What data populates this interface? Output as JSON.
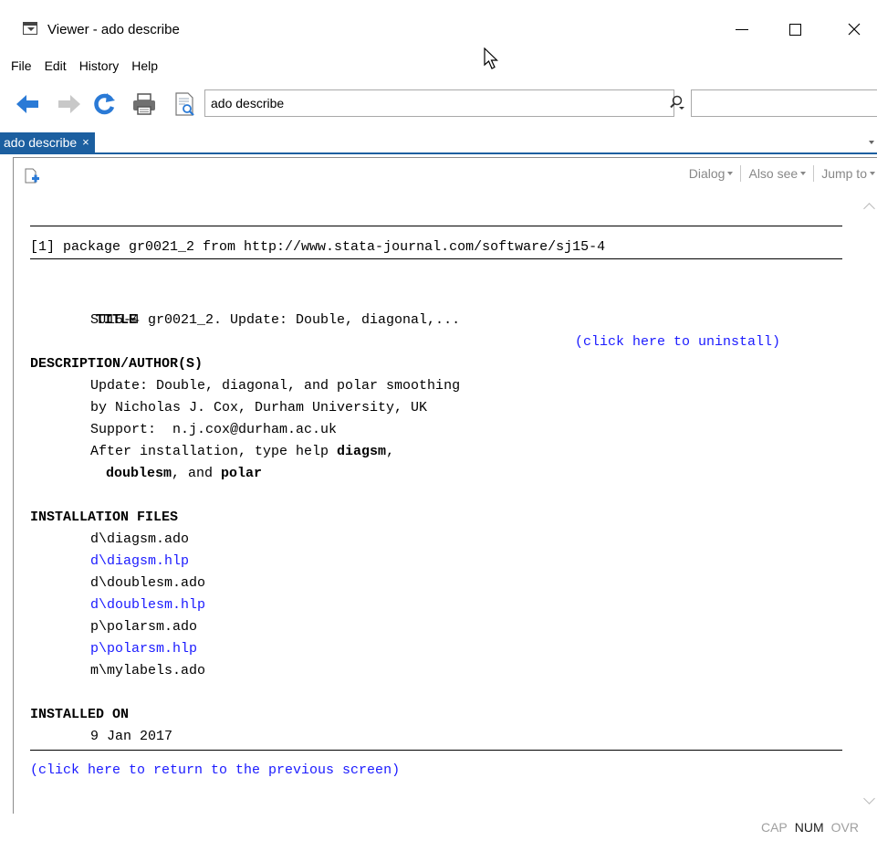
{
  "window": {
    "title": "Viewer - ado describe"
  },
  "menu": [
    "File",
    "Edit",
    "History",
    "Help"
  ],
  "toolbar": {
    "url_value": "ado describe",
    "search_value": ""
  },
  "tab": {
    "label": "ado describe",
    "close": "×"
  },
  "subbar": {
    "dialog": "Dialog",
    "also_see": "Also see",
    "jump_to": "Jump to"
  },
  "doc": {
    "package_line": "[1] package gr0021_2 from http://www.stata-journal.com/software/sj15-4",
    "title_heading": "TITLE",
    "uninstall_link": "(click here to uninstall)",
    "title_text": "SJ15-4 gr0021_2. Update: Double, diagonal,...",
    "desc_heading": "DESCRIPTION/AUTHOR(S)",
    "desc_lines": [
      "Update: Double, diagonal, and polar smoothing",
      "by Nicholas J. Cox, Durham University, UK",
      "Support:  n.j.cox@durham.ac.uk"
    ],
    "after_install_prefix": "After installation, type help ",
    "after_install_cmd1": "diagsm",
    "after_install_sep": ",",
    "after_install_cmd2": "doublesm",
    "after_install_and": ", and ",
    "after_install_cmd3": "polar",
    "files_heading": "INSTALLATION FILES",
    "files": [
      {
        "name": "d\\diagsm.ado",
        "link": false
      },
      {
        "name": "d\\diagsm.hlp",
        "link": true
      },
      {
        "name": "d\\doublesm.ado",
        "link": false
      },
      {
        "name": "d\\doublesm.hlp",
        "link": true
      },
      {
        "name": "p\\polarsm.ado",
        "link": false
      },
      {
        "name": "p\\polarsm.hlp",
        "link": true
      },
      {
        "name": "m\\mylabels.ado",
        "link": false
      }
    ],
    "installed_heading": "INSTALLED ON",
    "installed_date": "9 Jan 2017",
    "return_link": "(click here to return to the previous screen)"
  },
  "status": {
    "cap": "CAP",
    "num": "NUM",
    "ovr": "OVR"
  },
  "colors": {
    "tab_blue": "#1c5fa0",
    "link_blue": "#1a1aff",
    "back_arrow": "#2a7ad6",
    "refresh": "#2a7ad6"
  }
}
